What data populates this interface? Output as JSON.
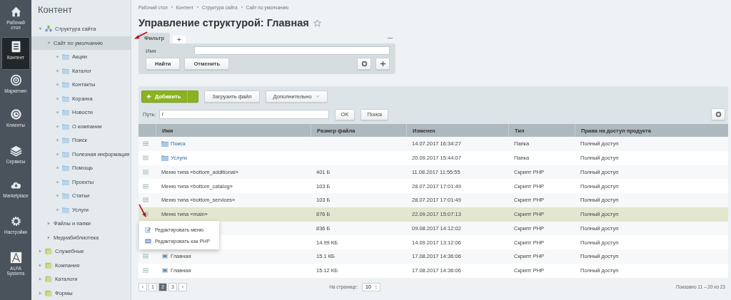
{
  "nav": [
    {
      "label": "Рабочий стол",
      "selected": false
    },
    {
      "label": "Контент",
      "selected": true
    },
    {
      "label": "Маркетинг",
      "selected": false
    },
    {
      "label": "Клиенты",
      "selected": false
    },
    {
      "label": "Сервисы",
      "selected": false
    },
    {
      "label": "Marketplace",
      "selected": false
    },
    {
      "label": "Настройки",
      "selected": false
    },
    {
      "label": "ALFA Systems",
      "selected": false
    }
  ],
  "tree": {
    "title": "Контент",
    "items": [
      {
        "label": "Структура сайта",
        "kind": "site",
        "expanded": true,
        "selected": false,
        "children": [
          {
            "label": "Сайт по умолчанию",
            "expanded": true,
            "selected": true,
            "children": [
              {
                "label": "Акции",
                "kind": "folder",
                "expanded": false,
                "selected": false
              },
              {
                "label": "Каталог",
                "kind": "folder",
                "expanded": false,
                "selected": false
              },
              {
                "label": "Контакты",
                "kind": "folder",
                "expanded": false,
                "selected": false
              },
              {
                "label": "Корзина",
                "kind": "folder",
                "expanded": false,
                "selected": false
              },
              {
                "label": "Новости",
                "kind": "folder",
                "expanded": false,
                "selected": false
              },
              {
                "label": "О компании",
                "kind": "folder",
                "expanded": false,
                "selected": false
              },
              {
                "label": "Поиск",
                "kind": "folder",
                "expanded": false,
                "selected": false
              },
              {
                "label": "Полезная информация",
                "kind": "folder",
                "expanded": false,
                "selected": false
              },
              {
                "label": "Помощь",
                "kind": "folder",
                "expanded": false,
                "selected": false
              },
              {
                "label": "Проекты",
                "kind": "folder",
                "expanded": false,
                "selected": false
              },
              {
                "label": "Статьи",
                "kind": "folder",
                "expanded": false,
                "selected": false
              },
              {
                "label": "Услуги",
                "kind": "folder",
                "expanded": false,
                "selected": false
              }
            ]
          },
          {
            "label": "Файлы и папки",
            "expanded": false,
            "selected": false
          },
          {
            "label": "Медиабиблиотека",
            "expanded": false,
            "selected": false
          }
        ]
      },
      {
        "label": "Служебные",
        "kind": "section",
        "expanded": false,
        "selected": false
      },
      {
        "label": "Компания",
        "kind": "section",
        "expanded": false,
        "selected": false
      },
      {
        "label": "Каталоги",
        "kind": "section",
        "expanded": false,
        "selected": false
      },
      {
        "label": "Формы",
        "kind": "section",
        "expanded": false,
        "selected": false
      }
    ]
  },
  "breadcrumbs": [
    "Рабочий стол",
    "Контент",
    "Структура сайта",
    "Сайт по умолчанию"
  ],
  "title": "Управление структурой: Главная",
  "filter": {
    "tabs": [
      {
        "label": "Фильтр",
        "selected": true
      },
      {
        "label": "+",
        "selected": false
      }
    ],
    "field_label": "Имя",
    "buttons": [
      "Найти",
      "Отменить"
    ]
  },
  "toolbar": {
    "add": "Добавить",
    "upload": "Загрузить файл",
    "more": "Дополнительно"
  },
  "path": {
    "label": "Путь:",
    "value": "/",
    "ok": "OK",
    "search": "Поиск"
  },
  "table": {
    "columns": [
      "Имя",
      "Размер файла",
      "Изменен",
      "Тип",
      "Права на доступ продукта"
    ],
    "rows": [
      {
        "kind": "folder",
        "name": "Поиск",
        "modified": "14.07.2017 16:34:27",
        "type": "Папка",
        "access": "Полный доступ",
        "selected": false
      },
      {
        "kind": "folder",
        "name": "Услуги",
        "modified": "20.09.2017 15:44:07",
        "type": "Папка",
        "access": "Полный доступ",
        "selected": false
      },
      {
        "kind": "menu",
        "name": "Меню типа «bottom_additional»",
        "size": "401 Б",
        "modified": "11.08.2017 11:55:55",
        "type": "Скрипт PHP",
        "access": "Полный доступ",
        "selected": false
      },
      {
        "kind": "menu",
        "name": "Меню типа «bottom_catalog»",
        "size": "103 Б",
        "modified": "28.07.2017 17:01:49",
        "type": "Скрипт PHP",
        "access": "Полный доступ",
        "selected": false
      },
      {
        "kind": "menu",
        "name": "Меню типа «bottom_services»",
        "size": "103 Б",
        "modified": "28.07.2017 17:01:49",
        "type": "Скрипт PHP",
        "access": "Полный доступ",
        "selected": false
      },
      {
        "kind": "menu",
        "name": "Меню типа «main»",
        "size": "876 Б",
        "modified": "22.09.2017 15:07:13",
        "type": "Скрипт PHP",
        "access": "Полный доступ",
        "selected": true
      },
      {
        "kind": "menu",
        "size": "836 Б",
        "modified": "09.08.2017 14:12:02",
        "type": "Скрипт PHP",
        "access": "Полный доступ",
        "selected": false
      },
      {
        "kind": "page",
        "size": "14.99 КБ",
        "modified": "14.09.2017 13:12:06",
        "type": "Скрипт PHP",
        "access": "Полный доступ",
        "selected": false
      },
      {
        "kind": "page",
        "name": "Главная",
        "size": "15.1 КБ",
        "modified": "17.08.2017 14:36:06",
        "type": "Скрипт PHP",
        "access": "Полный доступ",
        "selected": false
      },
      {
        "kind": "page",
        "name": "Главная",
        "size": "15.12 КБ",
        "modified": "17.08.2017 14:36:06",
        "type": "Скрипт PHP",
        "access": "Полный доступ",
        "selected": false
      }
    ]
  },
  "context_menu": [
    {
      "label": "Редактировать меню"
    },
    {
      "label": "Редактировать как PHP"
    }
  ],
  "pagination": {
    "prev": "‹",
    "pages": [
      {
        "label": "1",
        "selected": false
      },
      {
        "label": "2",
        "selected": true
      },
      {
        "label": "3",
        "selected": false
      }
    ],
    "next": "›",
    "per_page_label": "На странице:",
    "per_page": "10",
    "shown": "Показано 11 – 20 из 23"
  }
}
